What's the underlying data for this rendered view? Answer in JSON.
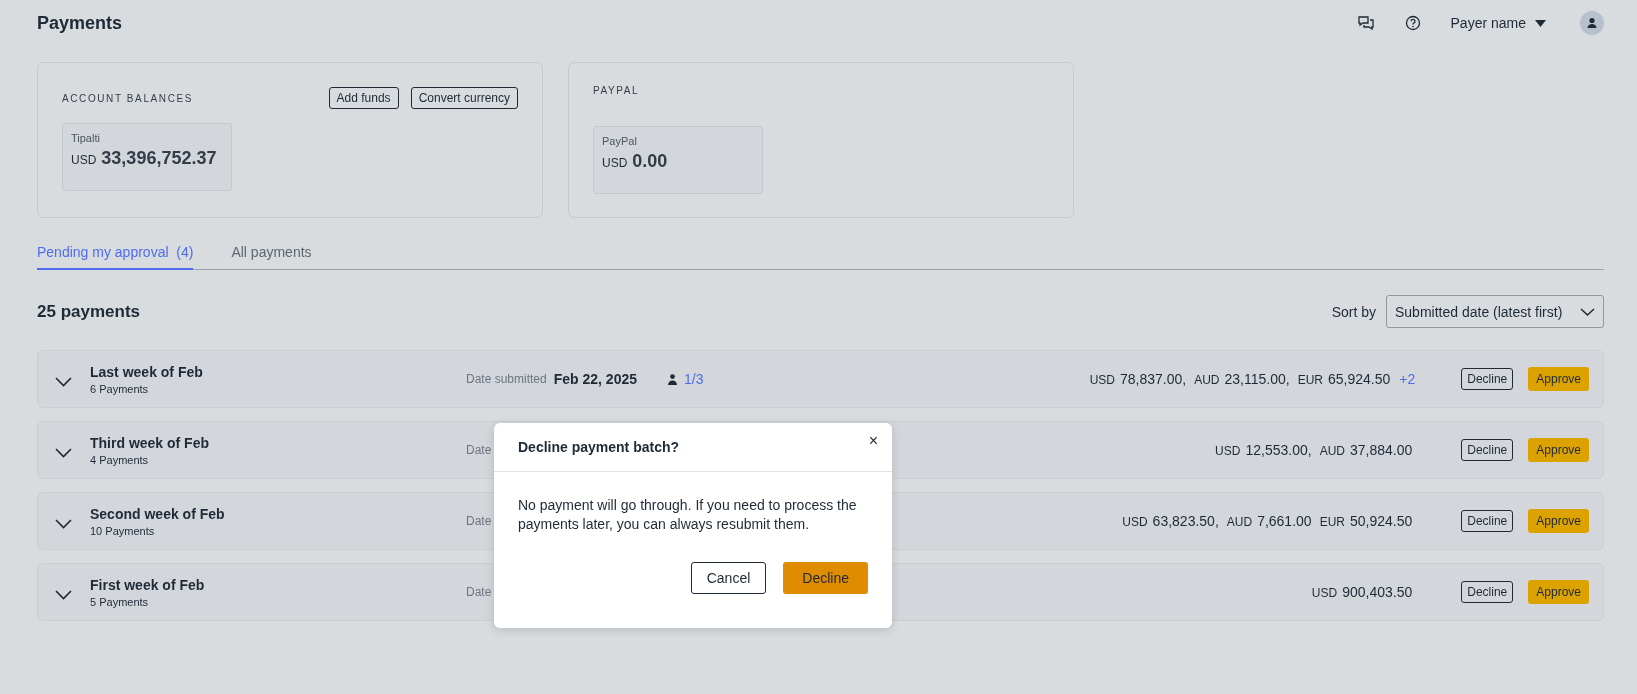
{
  "header": {
    "title": "Payments",
    "user_name": "Payer name"
  },
  "balance_cards": [
    {
      "kind": "account",
      "title": "ACCOUNT BALANCES",
      "actions": [
        "Add funds",
        "Convert currency"
      ],
      "tiles": [
        {
          "name": "Tipalti",
          "currency": "USD",
          "amount": "33,396,752.37"
        }
      ]
    },
    {
      "kind": "paypal",
      "title": "PAYPAL",
      "tiles": [
        {
          "name": "PayPal",
          "currency": "USD",
          "amount": "0.00"
        }
      ]
    }
  ],
  "tabs": [
    {
      "label": "Pending my approval",
      "count": "(4)",
      "selected": true
    },
    {
      "label": "All payments",
      "selected": false
    }
  ],
  "summary": {
    "title": "25 payments",
    "sort_label": "Sort by",
    "sort_value": "Submitted date (latest first)"
  },
  "batches": [
    {
      "title": "Last week of Feb",
      "subtitle": "6 Payments",
      "date_label": "Date submitted",
      "date": "Feb 22, 2025",
      "approvals": "1/3",
      "amounts": [
        {
          "currency": "USD",
          "amount": "78,837.00,"
        },
        {
          "currency": "AUD",
          "amount": "23,115.00,"
        },
        {
          "currency": "EUR",
          "amount": "65,924.50"
        }
      ],
      "more": "+2",
      "decline": "Decline",
      "approve": "Approve"
    },
    {
      "title": "Third week of Feb",
      "subtitle": "4 Payments",
      "date_label": "Date",
      "amounts": [
        {
          "currency": "USD",
          "amount": "12,553.00,"
        },
        {
          "currency": "AUD",
          "amount": "37,884.00"
        }
      ],
      "decline": "Decline",
      "approve": "Approve"
    },
    {
      "title": "Second week of Feb",
      "subtitle": "10 Payments",
      "date_label": "Date",
      "amounts": [
        {
          "currency": "USD",
          "amount": "63,823.50,"
        },
        {
          "currency": "AUD",
          "amount": "7,661.00"
        },
        {
          "currency": "EUR",
          "amount": "50,924.50"
        }
      ],
      "decline": "Decline",
      "approve": "Approve"
    },
    {
      "title": "First week of Feb",
      "subtitle": "5 Payments",
      "date_label": "Date",
      "amounts": [
        {
          "currency": "USD",
          "amount": "900,403.50"
        }
      ],
      "decline": "Decline",
      "approve": "Approve"
    }
  ],
  "dialog": {
    "title": "Decline payment batch?",
    "close": "×",
    "message": "No payment will go through. If you need to process the payments later, you can always resubmit them.",
    "cancel": "Cancel",
    "confirm": "Decline"
  }
}
